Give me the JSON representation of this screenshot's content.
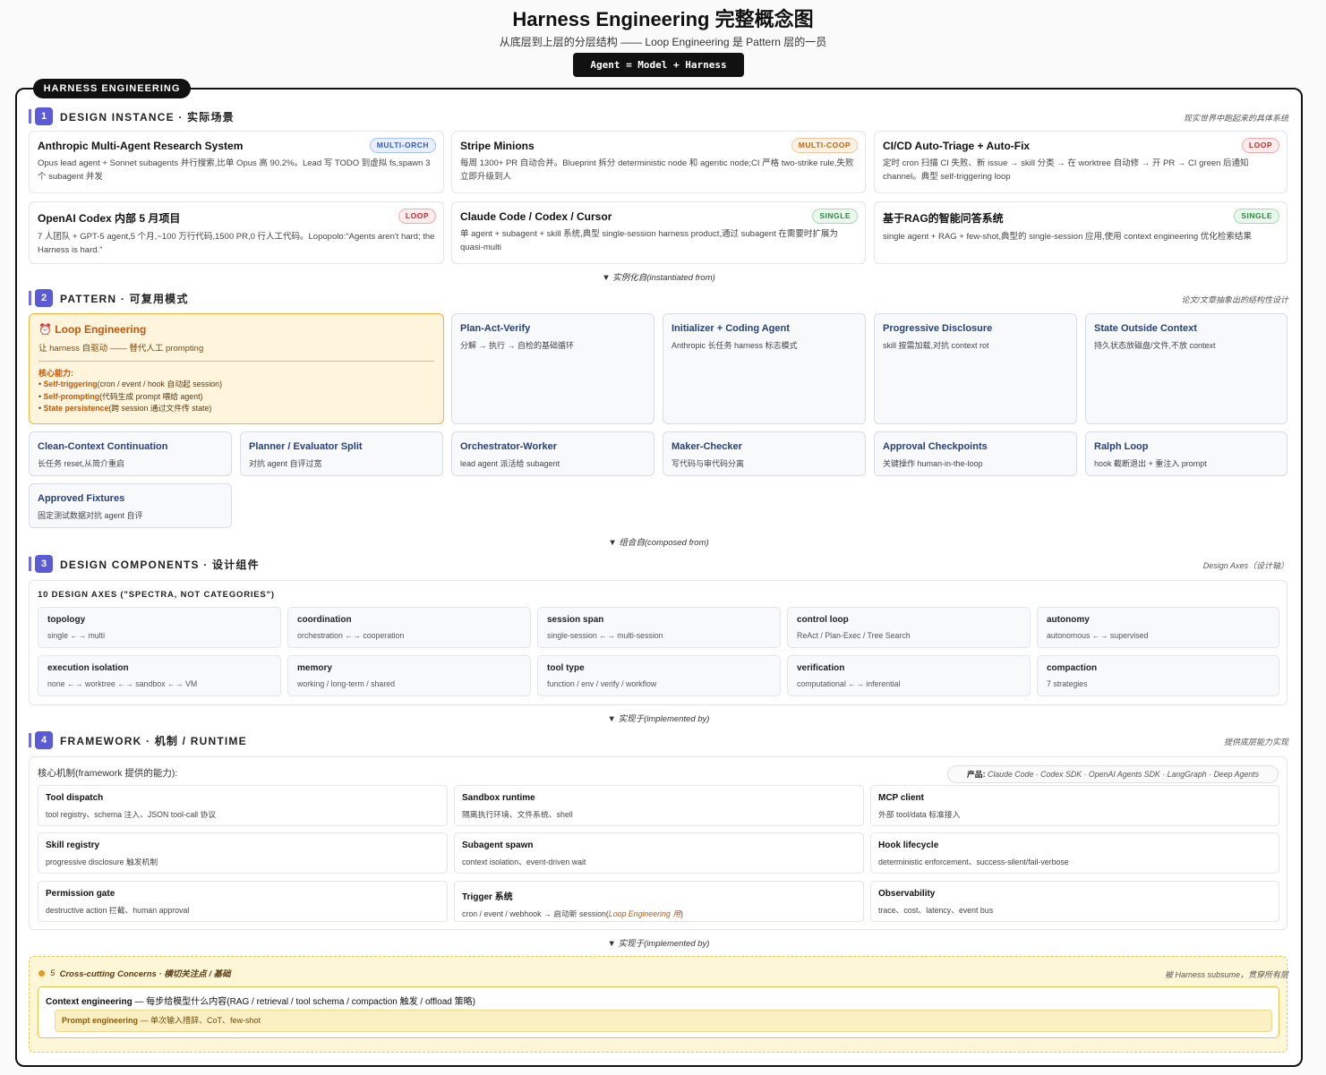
{
  "header": {
    "title": "Harness Engineering 完整概念图",
    "subtitle": "从底层到上层的分层结构 —— Loop Engineering 是 Pattern 层的一员",
    "formula": "Agent = Model + Harness"
  },
  "frame_tag": "HARNESS ENGINEERING",
  "sections": {
    "s1": {
      "num": "1",
      "label": "DESIGN INSTANCE · 实际场景",
      "note": "现实世界中跑起来的具体系统"
    },
    "s2": {
      "num": "2",
      "label": "PATTERN · 可复用模式",
      "note": "论文/文章抽象出的结构性设计"
    },
    "s3": {
      "num": "3",
      "label": "DESIGN COMPONENTS · 设计组件",
      "note": "Design Axes（设计轴）"
    },
    "s4": {
      "num": "4",
      "label": "FRAMEWORK · 机制 / RUNTIME",
      "note": "提供底层能力实现"
    }
  },
  "arrows": {
    "a1": "▼ 实例化自(instantiated from)",
    "a2": "▼ 组合自(composed from)",
    "a3": "▼ 实现于(implemented by)",
    "a4": "▼ 实现于(implemented by)"
  },
  "instances": [
    {
      "title": "Anthropic Multi-Agent Research System",
      "badge": "MULTI-ORCH",
      "desc": "Opus lead agent + Sonnet subagents 并行搜索,比单 Opus 高 90.2%。Lead 写 TODO 到虚拟 fs,spawn 3 个 subagent 并发"
    },
    {
      "title": "Stripe Minions",
      "badge": "MULTI-COOP",
      "desc": "每周 1300+ PR 自动合并。Blueprint 拆分 deterministic node 和 agentic node;CI 严格 two-strike rule,失败立即升级到人"
    },
    {
      "title": "CI/CD Auto-Triage + Auto-Fix",
      "badge": "LOOP",
      "desc": "定时 cron 扫描 CI 失败、新 issue → skill 分类 → 在 worktree 自动修 → 开 PR → CI green 后通知 channel。典型 self-triggering loop"
    },
    {
      "title": "OpenAI Codex 内部 5 月项目",
      "badge": "LOOP",
      "desc": "7 人团队 + GPT-5 agent,5 个月,~100 万行代码,1500 PR,0 行人工代码。Lopopolo:\"Agents aren't hard; the Harness is hard.\""
    },
    {
      "title": "Claude Code / Codex / Cursor",
      "badge": "SINGLE",
      "desc": "单 agent + subagent + skill 系统,典型 single-session harness product,通过 subagent 在需要时扩展为 quasi-multi"
    },
    {
      "title": "基于RAG的智能问答系统",
      "badge": "SINGLE",
      "desc": "single agent + RAG + few-shot,典型的 single-session 应用,使用 context engineering 优化检索结果"
    }
  ],
  "loop_card": {
    "icon": "⏰",
    "title": "Loop Engineering",
    "subtitle": "让 harness 自驱动 —— 替代人工 prompting",
    "cap_label": "核心能力:",
    "items": [
      {
        "name": "Self-triggering",
        "rest": "(cron / event / hook 自动起 session)"
      },
      {
        "name": "Self-prompting",
        "rest": "(代码生成 prompt 喂给 agent)"
      },
      {
        "name": "State persistence",
        "rest": "(跨 session 通过文件传 state)"
      }
    ]
  },
  "patterns": [
    {
      "title": "Plan-Act-Verify",
      "desc": "分解 → 执行 → 自检的基础循环"
    },
    {
      "title": "Initializer + Coding Agent",
      "desc": "Anthropic 长任务 harness 标志模式"
    },
    {
      "title": "Progressive Disclosure",
      "desc": "skill 按需加载,对抗 context rot"
    },
    {
      "title": "State Outside Context",
      "desc": "持久状态放磁盘/文件,不放 context"
    },
    {
      "title": "Clean-Context Continuation",
      "desc": "长任务 reset,从简介重启"
    },
    {
      "title": "Planner / Evaluator Split",
      "desc": "对抗 agent 自评过宽"
    },
    {
      "title": "Orchestrator-Worker",
      "desc": "lead agent 派活给 subagent"
    },
    {
      "title": "Maker-Checker",
      "desc": "写代码与审代码分离"
    },
    {
      "title": "Approval Checkpoints",
      "desc": "关键操作 human-in-the-loop"
    },
    {
      "title": "Ralph Loop",
      "desc": "hook 截断退出 + 重注入 prompt"
    },
    {
      "title": "Approved Fixtures",
      "desc": "固定测试数据对抗 agent 自评"
    }
  ],
  "axes": {
    "title": "10 DESIGN AXES (\"SPECTRA, NOT CATEGORIES\")",
    "items": [
      {
        "name": "topology",
        "desc": "single ←→ multi"
      },
      {
        "name": "coordination",
        "desc": "orchestration ←→ cooperation"
      },
      {
        "name": "session span",
        "desc": "single-session ←→ multi-session"
      },
      {
        "name": "control loop",
        "desc": "ReAct / Plan-Exec / Tree Search"
      },
      {
        "name": "autonomy",
        "desc": "autonomous ←→ supervised"
      },
      {
        "name": "execution isolation",
        "desc": "none ←→ worktree ←→ sandbox ←→ VM"
      },
      {
        "name": "memory",
        "desc": "working / long-term / shared"
      },
      {
        "name": "tool type",
        "desc": "function / env / verify / workflow"
      },
      {
        "name": "verification",
        "desc": "computational ←→ inferential"
      },
      {
        "name": "compaction",
        "desc": "7 strategies"
      }
    ]
  },
  "framework": {
    "intro": "核心机制(framework 提供的能力):",
    "products_label": "产品:",
    "products": "Claude Code · Codex SDK · OpenAI Agents SDK · LangGraph · Deep Agents",
    "items": [
      {
        "name": "Tool dispatch",
        "desc": "tool registry、schema 注入、JSON tool-call 协议"
      },
      {
        "name": "Sandbox runtime",
        "desc": "隔离执行环境、文件系统、shell"
      },
      {
        "name": "MCP client",
        "desc": "外部 tool/data 标准接入"
      },
      {
        "name": "Skill registry",
        "desc": "progressive disclosure 触发机制"
      },
      {
        "name": "Subagent spawn",
        "desc": "context isolation、event-driven wait"
      },
      {
        "name": "Hook lifecycle",
        "desc": "deterministic enforcement、success-silent/fail-verbose"
      },
      {
        "name": "Permission gate",
        "desc": "destructive action 拦截、human approval"
      },
      {
        "name": "Trigger 系统",
        "desc": "cron / event / webhook → 启动新 session(",
        "desc_em": "Loop Engineering 用",
        "desc_end": ")"
      },
      {
        "name": "Observability",
        "desc": "trace、cost、latency、event bus"
      }
    ]
  },
  "cross_cutting": {
    "num": "5",
    "label": "Cross-cutting Concerns · 横切关注点 / 基础",
    "note": "被 Harness subsume，贯穿所有层",
    "context_bold": "Context engineering",
    "context_rest": " — 每步给模型什么内容(RAG / retrieval / tool schema / compaction 触发 / offload 策略)",
    "prompt_bold": "Prompt engineering",
    "prompt_rest": " — 单次输入措辞、CoT、few-shot"
  },
  "colors": {
    "accent": "#5b5bd6",
    "loop_orange": "#c2580b",
    "pattern_blue": "#27427a",
    "cross_yellow": "#fdf7d8"
  }
}
